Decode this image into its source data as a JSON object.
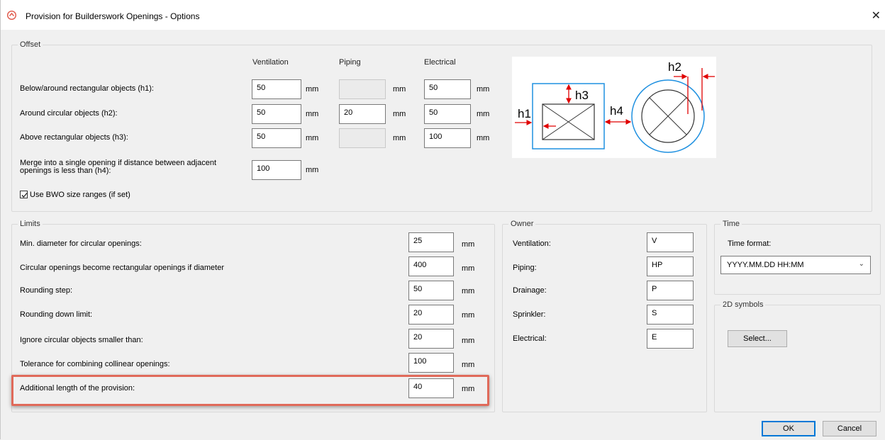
{
  "window": {
    "title": "Provision for Builderswork Openings - Options",
    "close_glyph": "✕"
  },
  "offset": {
    "label": "Offset",
    "columns": [
      "Ventilation",
      "Piping",
      "Electrical"
    ],
    "unit": "mm",
    "rows": [
      {
        "label": "Below/around rectangular objects (h1):",
        "ventilation": "50",
        "piping": "",
        "electrical": "50",
        "piping_enabled": false
      },
      {
        "label": "Around circular objects (h2):",
        "ventilation": "50",
        "piping": "20",
        "electrical": "50",
        "piping_enabled": true
      },
      {
        "label": "Above rectangular objects (h3):",
        "ventilation": "50",
        "piping": "",
        "electrical": "100",
        "piping_enabled": false
      }
    ],
    "merge_label": "Merge into a single opening if distance between adjacent openings is less than (h4):",
    "merge_value": "100",
    "checkbox_label": "Use BWO size ranges (if set)",
    "checkbox_checked": true,
    "diagram_labels": {
      "h1": "h1",
      "h2": "h2",
      "h3": "h3",
      "h4": "h4"
    }
  },
  "limits": {
    "label": "Limits",
    "unit": "mm",
    "rows": [
      {
        "label": "Min. diameter for circular openings:",
        "value": "25"
      },
      {
        "label": "Circular openings become rectangular openings if diameter",
        "value": "400"
      },
      {
        "label": "Rounding step:",
        "value": "50"
      },
      {
        "label": "Rounding down limit:",
        "value": "20"
      },
      {
        "label": "Ignore circular objects smaller than:",
        "value": "20"
      },
      {
        "label": "Tolerance for combining collinear openings:",
        "value": "100"
      },
      {
        "label": "Additional length of the provision:",
        "value": "40"
      }
    ]
  },
  "owner": {
    "label": "Owner",
    "rows": [
      {
        "label": "Ventilation:",
        "value": "V"
      },
      {
        "label": "Piping:",
        "value": "HP"
      },
      {
        "label": "Drainage:",
        "value": "P"
      },
      {
        "label": "Sprinkler:",
        "value": "S"
      },
      {
        "label": "Electrical:",
        "value": "E"
      }
    ]
  },
  "time": {
    "label": "Time",
    "format_label": "Time format:",
    "format_value": "YYYY.MM.DD HH:MM"
  },
  "symbols": {
    "label": "2D symbols",
    "select_button": "Select..."
  },
  "footer": {
    "ok": "OK",
    "cancel": "Cancel"
  },
  "colors": {
    "highlight": "#e06a5a",
    "diagram_blue": "#1e90e0",
    "arrow_red": "#e00000",
    "default_button": "#0078d7"
  }
}
